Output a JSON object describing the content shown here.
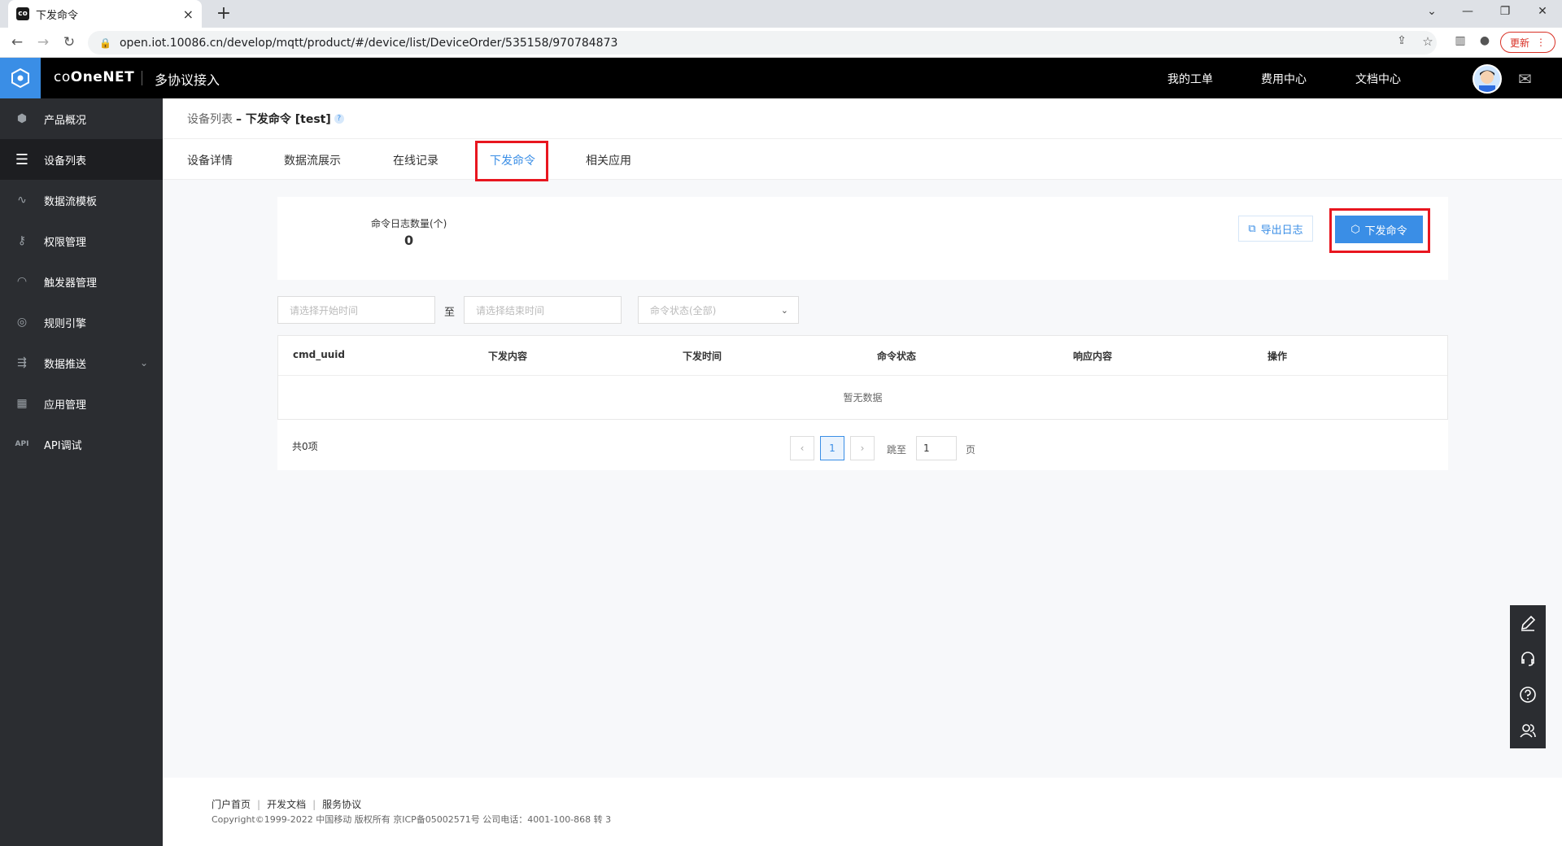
{
  "browser": {
    "tab_title": "下发命令",
    "favicon_text": "co",
    "url": "open.iot.10086.cn/develop/mqtt/product/#/device/list/DeviceOrder/535158/970784873",
    "update_label": "更新"
  },
  "header": {
    "brand": "OneNET",
    "product": "多协议接入",
    "links": [
      "我的工单",
      "费用中心",
      "文档中心"
    ]
  },
  "sidebar": {
    "items": [
      {
        "label": "产品概况",
        "icon": "cube-icon"
      },
      {
        "label": "设备列表",
        "icon": "list-icon"
      },
      {
        "label": "数据流模板",
        "icon": "flow-icon"
      },
      {
        "label": "权限管理",
        "icon": "key-icon"
      },
      {
        "label": "触发器管理",
        "icon": "trigger-icon"
      },
      {
        "label": "规则引擎",
        "icon": "rule-icon"
      },
      {
        "label": "数据推送",
        "icon": "push-icon"
      },
      {
        "label": "应用管理",
        "icon": "grid-icon"
      },
      {
        "label": "API调试",
        "icon": "api-icon"
      }
    ],
    "active_index": 1
  },
  "breadcrumb": {
    "parent": "设备列表",
    "current": "– 下发命令 [test]"
  },
  "tabs": [
    "设备详情",
    "数据流展示",
    "在线记录",
    "下发命令",
    "相关应用"
  ],
  "active_tab": "下发命令",
  "stats": {
    "label": "命令日志数量(个)",
    "value": "0"
  },
  "actions": {
    "export_label": "导出日志",
    "send_label": "下发命令"
  },
  "filters": {
    "start_placeholder": "请选择开始时间",
    "to_label": "至",
    "end_placeholder": "请选择结束时间",
    "status_placeholder": "命令状态(全部)"
  },
  "table": {
    "columns": [
      "cmd_uuid",
      "下发内容",
      "下发时间",
      "命令状态",
      "响应内容",
      "操作"
    ],
    "empty_text": "暂无数据"
  },
  "pagination": {
    "total_text": "共0项",
    "current_page": "1",
    "jump_label": "跳至",
    "jump_value": "1",
    "page_suffix": "页"
  },
  "footer": {
    "links": [
      "门户首页",
      "开发文档",
      "服务协议"
    ],
    "copyright": "Copyright©1999-2022 中国移动 版权所有 京ICP备05002571号 公司电话：4001-100-868 转 3"
  },
  "colors": {
    "accent": "#3a8ee6",
    "highlight": "#e8161f",
    "sidebar_bg": "#2b2d31"
  }
}
